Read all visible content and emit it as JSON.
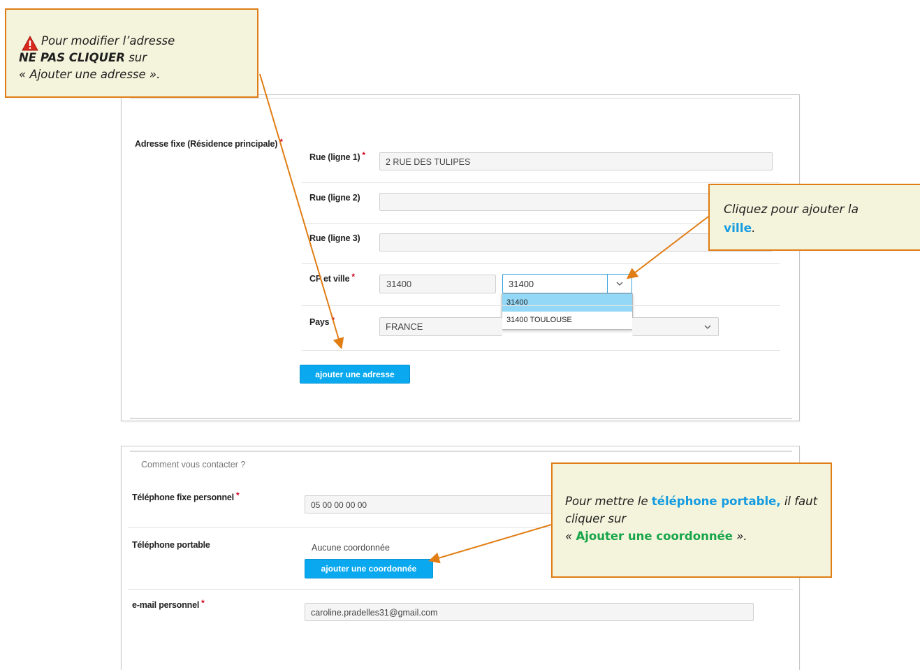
{
  "address": {
    "section_label": "Adresse fixe (Résidence principale)",
    "street1_label": "Rue (ligne 1)",
    "street1_value": "2 RUE DES TULIPES",
    "street2_label": "Rue (ligne 2)",
    "street2_value": "",
    "street3_label": "Rue (ligne 3)",
    "street3_value": "",
    "cp_city_label": "CP et ville",
    "cp_value": "31400",
    "city_select_value": "31400",
    "city_options": [
      "31400",
      "31400 TOULOUSE"
    ],
    "city_selected_index": 0,
    "country_label": "Pays",
    "country_value": "FRANCE",
    "add_address_button": "ajouter une adresse",
    "required_mark": "*"
  },
  "contact": {
    "section_title": "Comment vous contacter ?",
    "landline_label": "Téléphone fixe personnel",
    "landline_value": "05 00 00 00 00",
    "mobile_label": "Téléphone portable",
    "mobile_value": "Aucune coordonnée",
    "add_contact_button": "ajouter une coordonnée",
    "email_label": "e-mail personnel",
    "email_value": "caroline.pradelles31@gmail.com",
    "required_mark": "*"
  },
  "callouts": {
    "warning": {
      "icon": "warning-icon",
      "line1": "Pour modifier l’adresse",
      "line2_bold": "NE PAS CLIQUER",
      "line2_rest": " sur",
      "line3": "« Ajouter une adresse »."
    },
    "city": {
      "line1": "Cliquez pour ajouter la",
      "highlight": "ville",
      "end": "."
    },
    "phone": {
      "pre": "Pour mettre le ",
      "highlight1": "téléphone portable,",
      "mid": " il faut cliquer sur",
      "open_quote": "« ",
      "highlight2": "Ajouter une coordonnée",
      "close_quote": " »."
    }
  },
  "colors": {
    "button": "#0aa9ef",
    "callout_bg": "#f4f4dc",
    "callout_border": "#e07d14",
    "arrow": "#e07d14",
    "required": "#d0021b",
    "blue_text": "#149be0",
    "green_text": "#18a54a"
  }
}
